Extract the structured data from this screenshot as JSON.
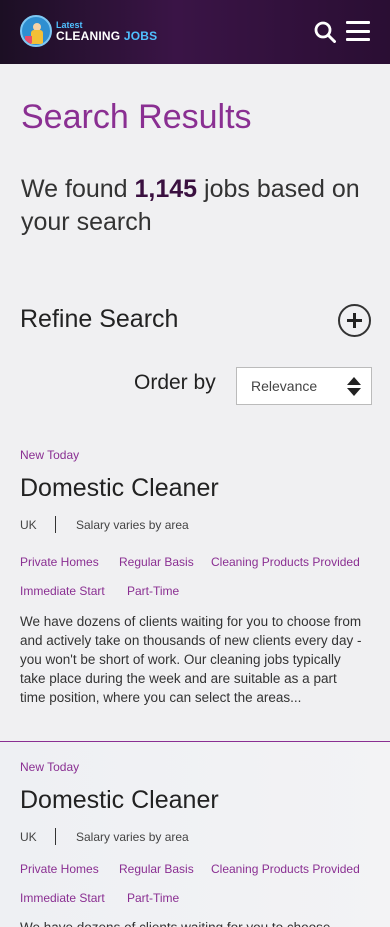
{
  "header": {
    "logo_top": "Latest",
    "logo_main": "CLEANING",
    "logo_accent": "JOBS",
    "icons": [
      "search-icon",
      "menu-icon"
    ]
  },
  "page": {
    "title": "Search Results",
    "found_prefix": "We found ",
    "found_count": "1,145",
    "found_suffix": " jobs based on your search"
  },
  "refine": {
    "label": "Refine Search",
    "icon": "plus-circle-icon"
  },
  "order": {
    "label": "Order by",
    "selected": "Relevance"
  },
  "jobs": [
    {
      "badge": "New Today",
      "title": "Domestic Cleaner",
      "location": "UK",
      "salary": "Salary varies by area",
      "tags": [
        "Private Homes",
        "Regular Basis",
        "Cleaning Products Provided",
        "Immediate Start",
        "Part-Time"
      ],
      "description": "We have dozens of clients waiting for you to choose from and actively take on thousands of new clients every day - you won't be short of work.  Our cleaning jobs typically take place during the week and are suitable as a part time position, where you can select the areas..."
    },
    {
      "badge": "New Today",
      "title": "Domestic Cleaner",
      "location": "UK",
      "salary": "Salary varies by area",
      "tags": [
        "Private Homes",
        "Regular Basis",
        "Cleaning Products Provided",
        "Immediate Start",
        "Part-Time"
      ],
      "description": "We have dozens of clients waiting for you to choose"
    }
  ],
  "colors": {
    "accent": "#8a2f92",
    "header": "#2a0e33",
    "logo_blue": "#4fc0ff"
  }
}
